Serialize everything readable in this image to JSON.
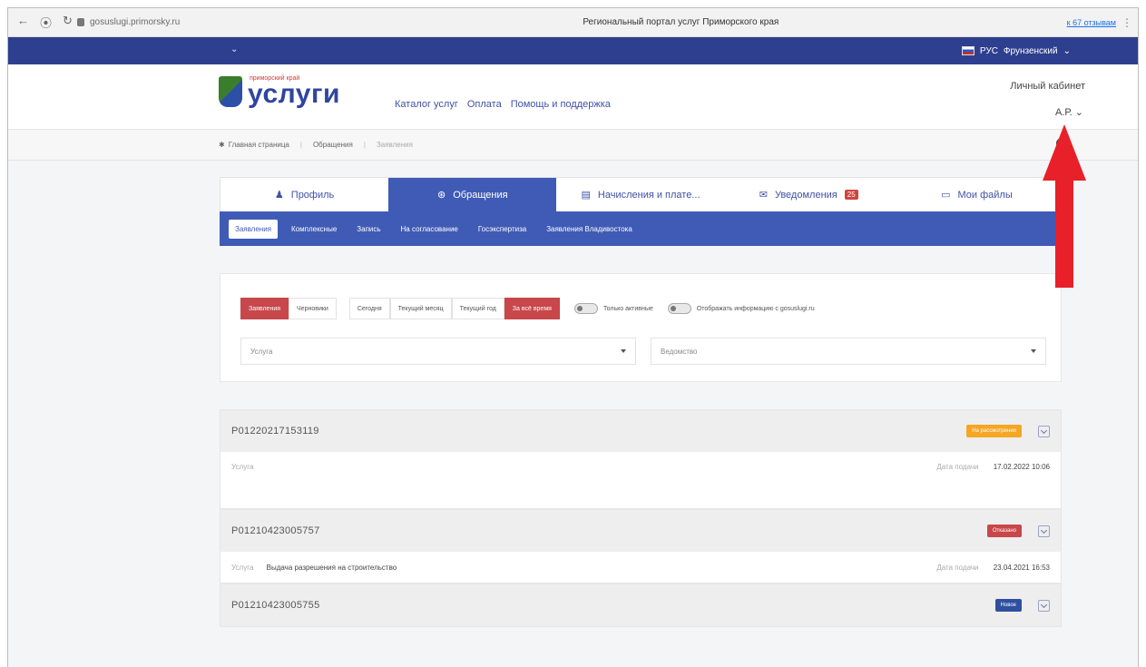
{
  "browser": {
    "back": "←",
    "forward": "⦿",
    "reload": "↻",
    "url": "gosuslugi.primorsky.ru",
    "title": "Региональный портал услуг Приморского края",
    "reviews": "к 67 отзывам",
    "more": "⋮"
  },
  "topbar": {
    "dropdown_caret": "⌄",
    "language": "РУС",
    "region": "Фрунзенский",
    "region_caret": "⌄"
  },
  "header": {
    "logo_small": "приморский край",
    "logo_big": "услуги",
    "nav": [
      "Каталог услуг",
      "Оплата",
      "Помощь и поддержка"
    ],
    "cabinet": "Личный кабинет",
    "user": "А.Р. ⌄"
  },
  "breadcrumbs": [
    "Главная страница",
    "Обращения",
    "Заявления"
  ],
  "tabs": [
    {
      "label": "Профиль",
      "icon": "user-icon",
      "glyph": "♟"
    },
    {
      "label": "Обращения",
      "icon": "requests-icon",
      "glyph": "⊛"
    },
    {
      "label": "Начисления и плате...",
      "icon": "payments-icon",
      "glyph": "▤"
    },
    {
      "label": "Уведомления",
      "icon": "notifications-icon",
      "glyph": "✉",
      "badge": "25"
    },
    {
      "label": "Мои файлы",
      "icon": "folder-icon",
      "glyph": "▭"
    }
  ],
  "subtabs": [
    "Заявления",
    "Комплексные",
    "Запись",
    "На согласование",
    "Госэкспертиза",
    "Заявления Владивостока"
  ],
  "filters": {
    "type_buttons": [
      "Заявления",
      "Черновики"
    ],
    "period_buttons": [
      "Сегодня",
      "Текущий месяц",
      "Текущий год",
      "За всё время"
    ],
    "toggle_active": "Только активные",
    "toggle_gosuslugi": "Отображать информацию с gosuslugi.ru",
    "service_placeholder": "Услуга",
    "agency_placeholder": "Ведомство"
  },
  "applications": [
    {
      "id": "P01220217153119",
      "status": "На рассмотрении",
      "status_color": "#f5a623",
      "service_label": "Услуга",
      "service": "",
      "date_label": "Дата подачи",
      "date": "17.02.2022 10:06"
    },
    {
      "id": "P01210423005757",
      "status": "Отказано",
      "status_color": "#c7474a",
      "service_label": "Услуга",
      "service": "Выдача разрешения на строительство",
      "date_label": "Дата подачи",
      "date": "23.04.2021 16:53"
    },
    {
      "id": "P01210423005755",
      "status": "Новое",
      "status_color": "#2f4f9f"
    }
  ],
  "colors": {
    "brand_blue": "#3f5bb5",
    "top_bar": "#2d3f8e",
    "accent_red": "#c7474a",
    "annotation_arrow": "#e8202a"
  }
}
